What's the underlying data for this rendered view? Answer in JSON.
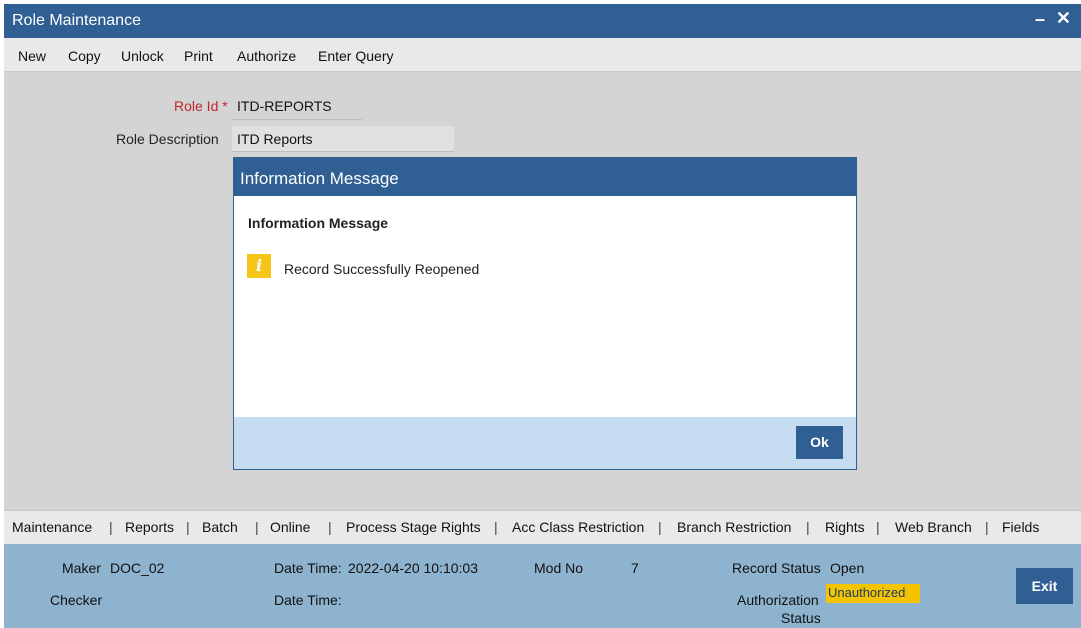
{
  "window": {
    "title": "Role Maintenance",
    "minimize_glyph": "–",
    "close_glyph": "✕"
  },
  "toolbar": [
    "New",
    "Copy",
    "Unlock",
    "Print",
    "Authorize",
    "Enter Query"
  ],
  "form": {
    "role_id_label": "Role Id",
    "required_mark": "*",
    "role_id_value": "ITD-REPORTS",
    "role_desc_label": "Role Description",
    "role_desc_value": "ITD Reports"
  },
  "dialog": {
    "title": "Information Message",
    "heading": "Information Message",
    "icon": "info-icon",
    "icon_glyph": "i",
    "message": "Record Successfully Reopened",
    "ok_label": "Ok"
  },
  "tabs": [
    "Maintenance",
    "Reports",
    "Batch",
    "Online",
    "Process Stage Rights",
    "Acc Class Restriction",
    "Branch Restriction",
    "Rights",
    "Web Branch",
    "Fields"
  ],
  "tab_separator": "|",
  "footer": {
    "maker_label": "Maker",
    "maker_value": "DOC_02",
    "checker_label": "Checker",
    "datetime_label": "Date Time:",
    "maker_datetime": "2022-04-20 10:10:03",
    "checker_datetime_label": "Date Time:",
    "modno_label": "Mod No",
    "modno_value": "7",
    "record_status_label": "Record Status",
    "record_status_value": "Open",
    "auth_status_label_1": "Authorization",
    "auth_status_label_2": "Status",
    "auth_status_value": "Unauthorized",
    "exit_label": "Exit"
  },
  "colors": {
    "title_bar": "#2f5f93",
    "background": "#d4d4d4",
    "footer": "#8eb3cf",
    "dialog_footer": "#c6ddf1",
    "badge": "#f4c400",
    "required": "#c0272d"
  }
}
